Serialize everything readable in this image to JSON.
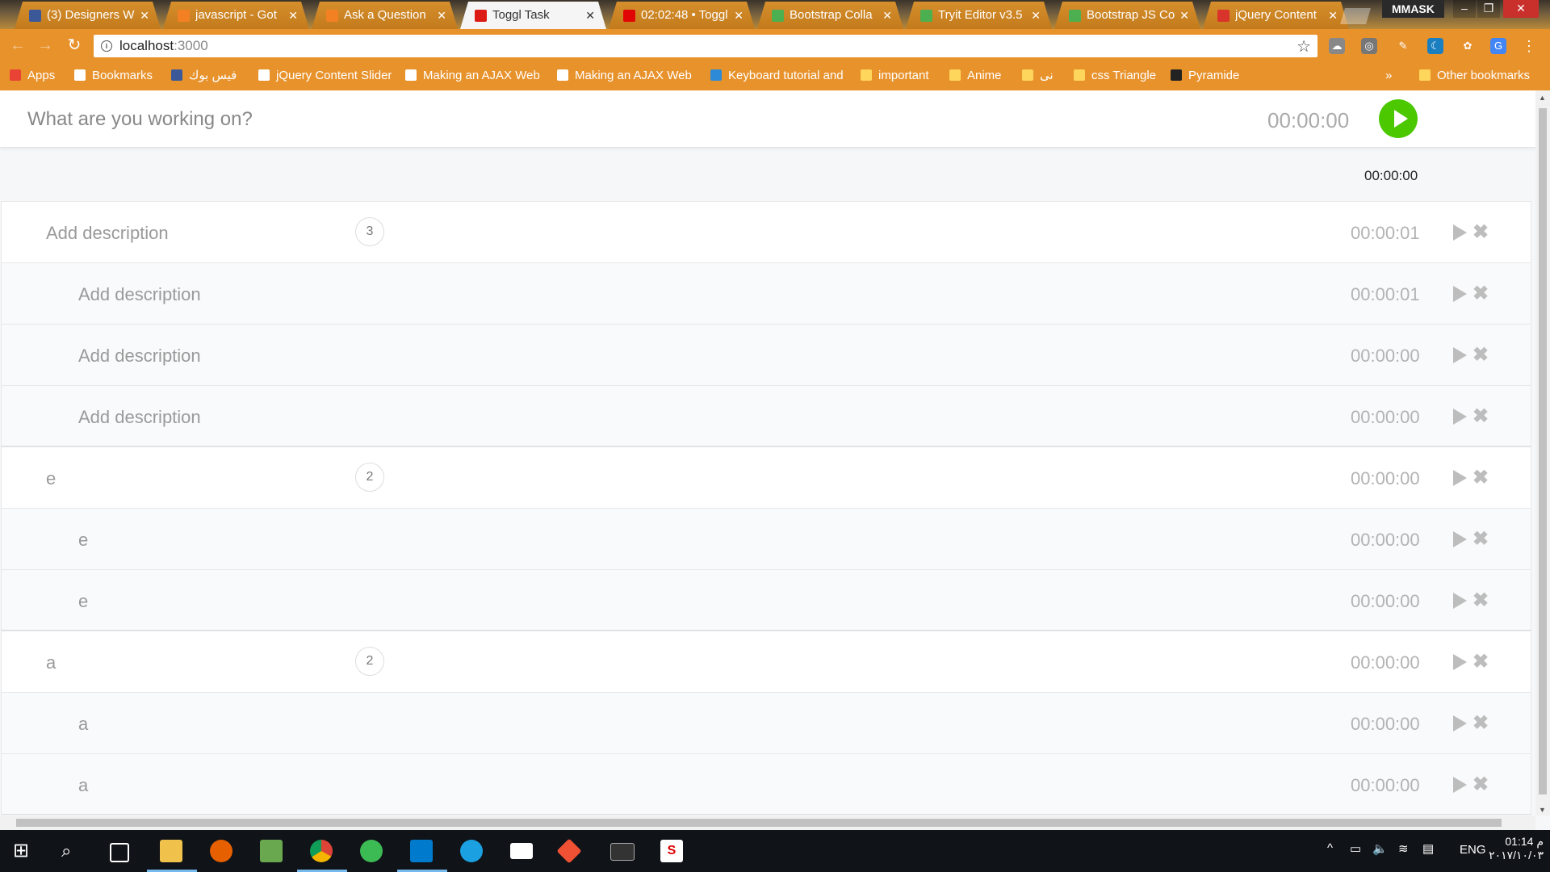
{
  "browser": {
    "tabs": [
      {
        "title": "(3) Designers W",
        "favicon": "facebook-icon",
        "color": "#3b5998"
      },
      {
        "title": "javascript - Got",
        "favicon": "stackoverflow-icon",
        "color": "#f48024"
      },
      {
        "title": "Ask a Question",
        "favicon": "stackoverflow-icon",
        "color": "#f48024"
      },
      {
        "title": "Toggl Task",
        "favicon": "angular-icon",
        "color": "#dd1b16",
        "active": true
      },
      {
        "title": "02:02:48 • Toggl",
        "favicon": "toggl-icon",
        "color": "#e20505"
      },
      {
        "title": "Bootstrap Colla",
        "favicon": "w3schools-icon",
        "color": "#4caf50"
      },
      {
        "title": "Tryit Editor v3.5",
        "favicon": "w3schools-icon",
        "color": "#4caf50"
      },
      {
        "title": "Bootstrap JS Co",
        "favicon": "w3schools-icon",
        "color": "#4caf50"
      },
      {
        "title": "jQuery Content",
        "favicon": "star-icon",
        "color": "#d9342b"
      }
    ],
    "profile_name": "MMASK",
    "address": {
      "host": "localhost",
      "port": ":3000"
    },
    "bookmarks": [
      {
        "label": "Apps",
        "icon": "apps-grid-icon"
      },
      {
        "label": "Bookmarks",
        "icon": "star-icon"
      },
      {
        "label": "فيس بوك",
        "icon": "facebook-icon"
      },
      {
        "label": "jQuery Content Slider",
        "icon": "star-icon"
      },
      {
        "label": "Making an AJAX Web",
        "icon": "code-icon"
      },
      {
        "label": "Making an AJAX Web",
        "icon": "code-icon"
      },
      {
        "label": "Keyboard tutorial and",
        "icon": "s-icon"
      },
      {
        "label": "important",
        "icon": "folder-icon"
      },
      {
        "label": "Anime",
        "icon": "folder-icon"
      },
      {
        "label": "نى",
        "icon": "folder-icon"
      },
      {
        "label": "css Triangle",
        "icon": "folder-icon"
      },
      {
        "label": "Pyramide",
        "icon": "codepen-icon"
      }
    ],
    "bookmarks_overflow": "»",
    "other_bookmarks": "Other bookmarks"
  },
  "timer": {
    "placeholder": "What are you working on?",
    "display": "00:00:00",
    "start_color": "#4bc800"
  },
  "day_total": "00:00:00",
  "entries": [
    {
      "description": "Add description",
      "count": "3",
      "duration": "00:00:01",
      "level": "group"
    },
    {
      "description": "Add description",
      "duration": "00:00:01",
      "level": "child"
    },
    {
      "description": "Add description",
      "duration": "00:00:00",
      "level": "child"
    },
    {
      "description": "Add description",
      "duration": "00:00:00",
      "level": "child"
    },
    {
      "description": "e",
      "count": "2",
      "duration": "00:00:00",
      "level": "group"
    },
    {
      "description": "e",
      "duration": "00:00:00",
      "level": "child"
    },
    {
      "description": "e",
      "duration": "00:00:00",
      "level": "child"
    },
    {
      "description": "a",
      "count": "2",
      "duration": "00:00:00",
      "level": "group"
    },
    {
      "description": "a",
      "duration": "00:00:00",
      "level": "child"
    },
    {
      "description": "a",
      "duration": "00:00:00",
      "level": "child"
    }
  ],
  "taskbar": {
    "language": "ENG",
    "time": "01:14 م",
    "date": "٢٠١٧/١٠/٠٣"
  }
}
